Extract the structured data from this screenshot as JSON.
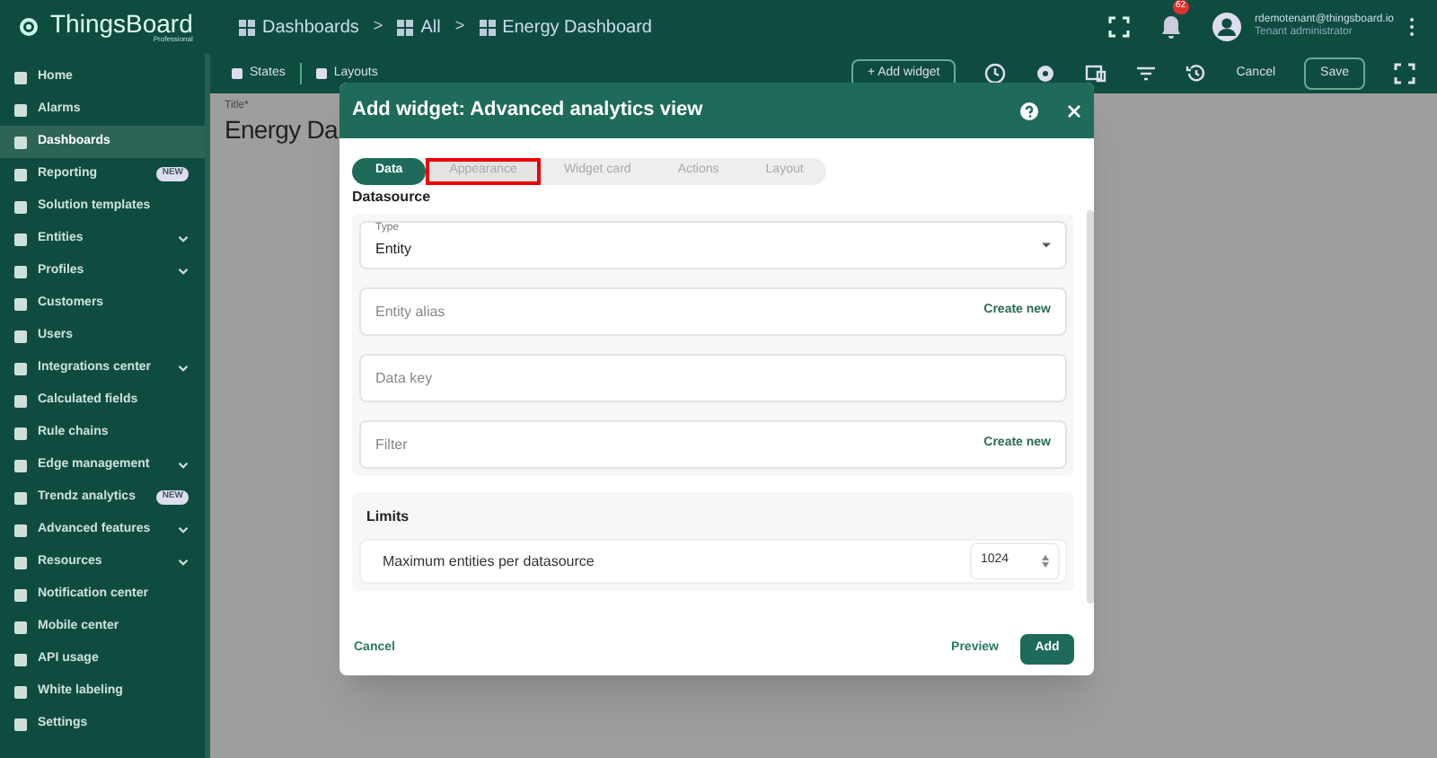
{
  "app": {
    "logo_name": "ThingsBoard",
    "logo_edition": "Professional"
  },
  "breadcrumbs": [
    {
      "label": "Dashboards",
      "kind": "crumb"
    },
    {
      "label": ">",
      "kind": "separator"
    },
    {
      "label": "All",
      "kind": "crumb"
    },
    {
      "label": ">",
      "kind": "separator"
    },
    {
      "label": "Energy Dashboard",
      "kind": "crumb"
    }
  ],
  "user": {
    "email": "rdemotenant@thingsboard.io",
    "role": "Tenant administrator",
    "notifications": "62"
  },
  "sidebar": {
    "items": [
      {
        "label": "Home",
        "selected": false,
        "expandable": false
      },
      {
        "label": "Alarms",
        "selected": false,
        "expandable": false
      },
      {
        "label": "Dashboards",
        "selected": true,
        "expandable": false
      },
      {
        "label": "Reporting",
        "selected": false,
        "expandable": false,
        "badge": "NEW"
      },
      {
        "label": "Solution templates",
        "selected": false,
        "expandable": false
      },
      {
        "label": "Entities",
        "selected": false,
        "expandable": true
      },
      {
        "label": "Profiles",
        "selected": false,
        "expandable": true
      },
      {
        "label": "Customers",
        "selected": false,
        "expandable": false
      },
      {
        "label": "Users",
        "selected": false,
        "expandable": false
      },
      {
        "label": "Integrations center",
        "selected": false,
        "expandable": true
      },
      {
        "label": "Calculated fields",
        "selected": false,
        "expandable": false
      },
      {
        "label": "Rule chains",
        "selected": false,
        "expandable": false
      },
      {
        "label": "Edge management",
        "selected": false,
        "expandable": true
      },
      {
        "label": "Trendz analytics",
        "selected": false,
        "expandable": false,
        "badge": "NEW"
      },
      {
        "label": "Advanced features",
        "selected": false,
        "expandable": true
      },
      {
        "label": "Resources",
        "selected": false,
        "expandable": true
      },
      {
        "label": "Notification center",
        "selected": false,
        "expandable": false
      },
      {
        "label": "Mobile center",
        "selected": false,
        "expandable": false
      },
      {
        "label": "API usage",
        "selected": false,
        "expandable": false
      },
      {
        "label": "White labeling",
        "selected": false,
        "expandable": false
      },
      {
        "label": "Settings",
        "selected": false,
        "expandable": false
      }
    ]
  },
  "toolbar": {
    "left": [
      "States",
      "Layouts"
    ],
    "add_widget": "+ Add widget",
    "cancel": "Cancel",
    "save": "Save"
  },
  "dashboard": {
    "title_label": "Title*",
    "title": "Energy Da"
  },
  "dialog": {
    "title": "Add widget:  Advanced analytics view",
    "tabs": [
      {
        "label": "Data",
        "selected": true,
        "highlighted": false
      },
      {
        "label": "Appearance",
        "selected": false,
        "highlighted": true
      },
      {
        "label": "Widget card",
        "selected": false,
        "highlighted": false
      },
      {
        "label": "Actions",
        "selected": false,
        "highlighted": false
      },
      {
        "label": "Layout",
        "selected": false,
        "highlighted": false
      }
    ],
    "datasource": {
      "heading": "Datasource",
      "type_label": "Type",
      "type_value": "Entity",
      "fields": [
        {
          "placeholder": "Entity alias",
          "action": "Create new"
        },
        {
          "placeholder": "Data key"
        },
        {
          "placeholder": "Filter",
          "action": "Create new"
        }
      ]
    },
    "limits": {
      "heading": "Limits",
      "label": "Maximum entities per datasource",
      "value": "1024"
    },
    "buttons": {
      "cancel": "Cancel",
      "preview": "Preview",
      "add": "Add"
    }
  }
}
